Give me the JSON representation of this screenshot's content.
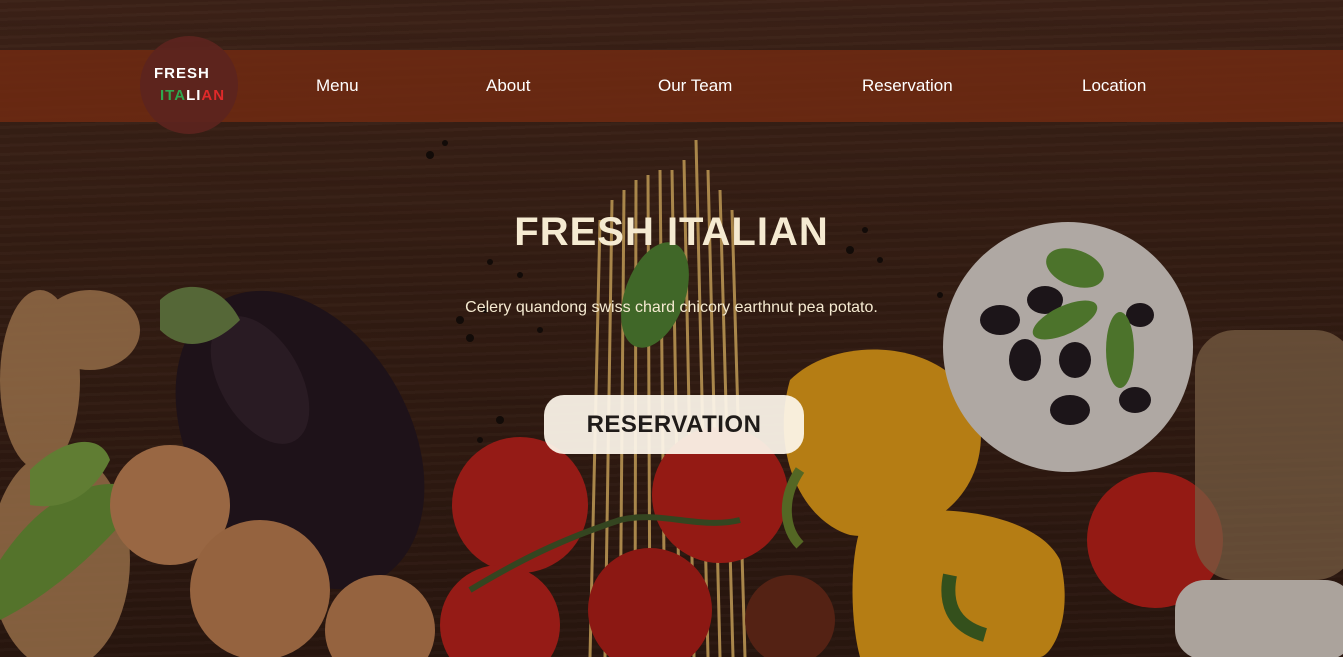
{
  "logo": {
    "line1": "FRESH",
    "line2_parts": [
      "ITA",
      "LI",
      "AN"
    ]
  },
  "nav": {
    "items": [
      "Menu",
      "About",
      "Our Team",
      "Reservation",
      "Location"
    ]
  },
  "hero": {
    "title": "FRESH ITALIAN",
    "subtitle": "Celery quandong swiss chard chicory earthnut pea potato.",
    "cta_label": "RESERVATION"
  },
  "colors": {
    "nav_bg": "#702a12",
    "title": "#f5ead1",
    "logo_green": "#2fa84f",
    "logo_white": "#ffffff",
    "logo_red": "#e02a2a",
    "cta_bg": "#fdf6eb"
  }
}
